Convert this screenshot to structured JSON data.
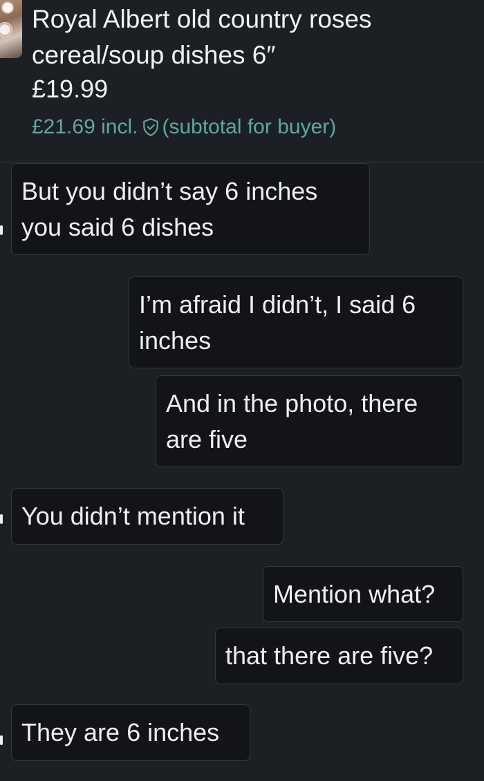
{
  "item": {
    "title": "Royal Albert old country roses cereal/soup dishes 6″",
    "price": "£19.99",
    "buyer_price": "£21.69 incl.",
    "buyer_note": "(subtotal for buyer)",
    "protection_icon": "shield-check-icon",
    "price_accent_color": "#5fa8a0"
  },
  "messages": [
    {
      "direction": "incoming",
      "text": "But you didn’t say 6 inches you said 6 dishes"
    },
    {
      "direction": "outgoing",
      "text": "I’m afraid I didn’t, I said 6 inches"
    },
    {
      "direction": "outgoing",
      "text": "And in the photo, there are five"
    },
    {
      "direction": "incoming",
      "text": "You didn’t mention it"
    },
    {
      "direction": "outgoing",
      "text": "Mention what?"
    },
    {
      "direction": "outgoing",
      "text": "that there are five?"
    },
    {
      "direction": "incoming",
      "text": "They are 6 inches"
    }
  ]
}
